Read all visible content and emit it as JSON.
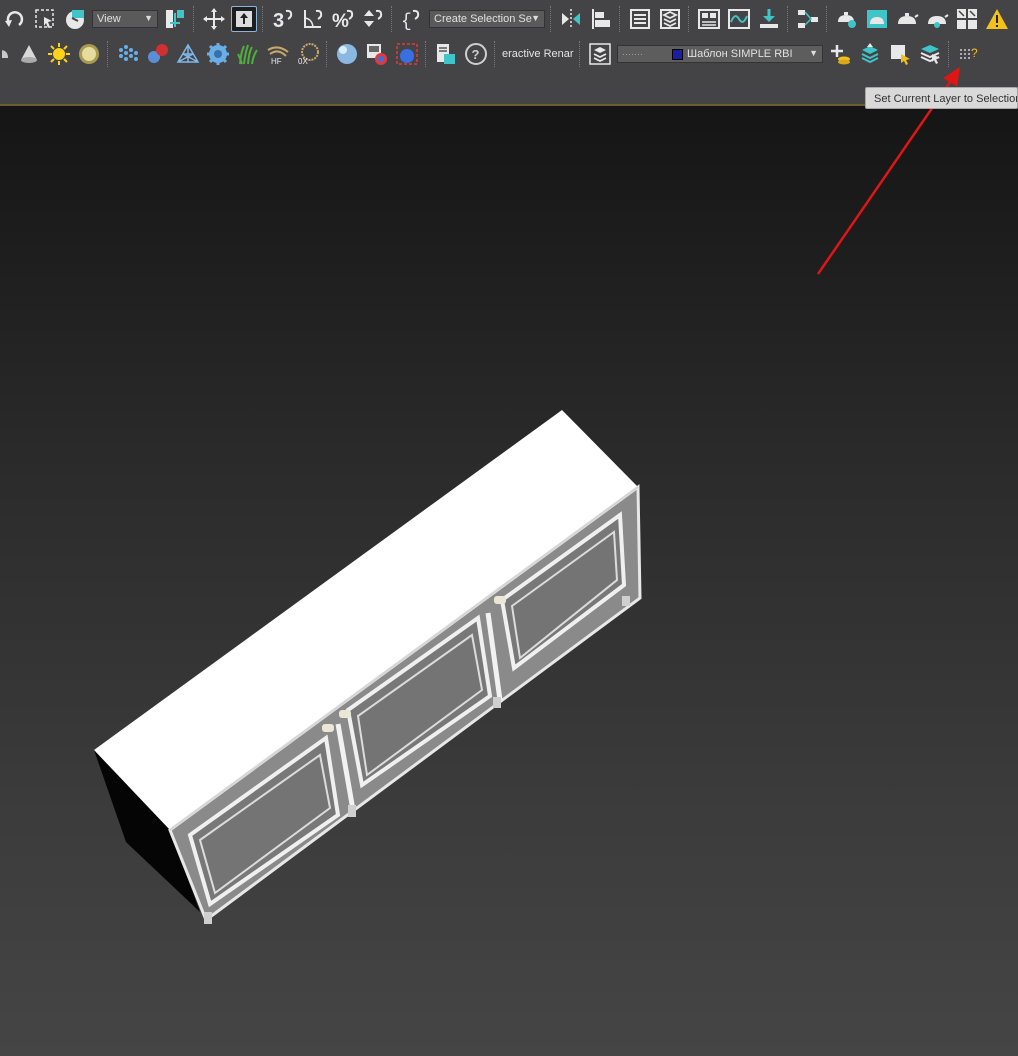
{
  "toolbar": {
    "reference_coord_dropdown": "View",
    "selection_set_dropdown": "Create Selection Se",
    "renderer_label": "eractive Renar",
    "layer_dropdown": "Шаблон SIMPLE RBI",
    "icons_row1": [
      "redo-icon",
      "select-region-icon",
      "select-object-icon",
      "move-icon",
      "select-and-place-icon",
      "snap-3d-icon",
      "angle-snap-icon",
      "percent-snap-icon",
      "spinner-snap-icon",
      "edit-named-selection-icon",
      "mirror-icon",
      "align-icon",
      "scene-explorer-icon",
      "layer-explorer-icon",
      "toggle-ribbon-icon",
      "curve-editor-icon",
      "dope-sheet-icon",
      "schematic-view-icon",
      "render-setup-icon",
      "rendered-frame-window-icon",
      "render-production-icon",
      "render-active-shade-icon",
      "render-iterative-icon",
      "warning-icon"
    ],
    "icons_row2": [
      "teapot-icon",
      "cone-icon",
      "sun-light-icon",
      "sphere-light-icon",
      "array-icon",
      "material-icon",
      "mesh-icon",
      "gear-icon",
      "grass-icon",
      "hair-fur-icon",
      "scatter-icon",
      "material-sphere-icon",
      "material-browser-icon",
      "render-frame-icon",
      "batch-render-icon",
      "help-icon",
      "layer-manager-icon",
      "create-new-layer-icon",
      "add-selection-to-layer-icon",
      "select-objects-in-layer-icon",
      "set-current-layer-icon",
      "more-tools-icon"
    ]
  },
  "tooltip": "Set Current Layer to Selection",
  "colors": {
    "accent_teal": "#3fc4c9",
    "annotation_arrow": "#e01515",
    "layer_swatch": "#1a1fa0"
  }
}
